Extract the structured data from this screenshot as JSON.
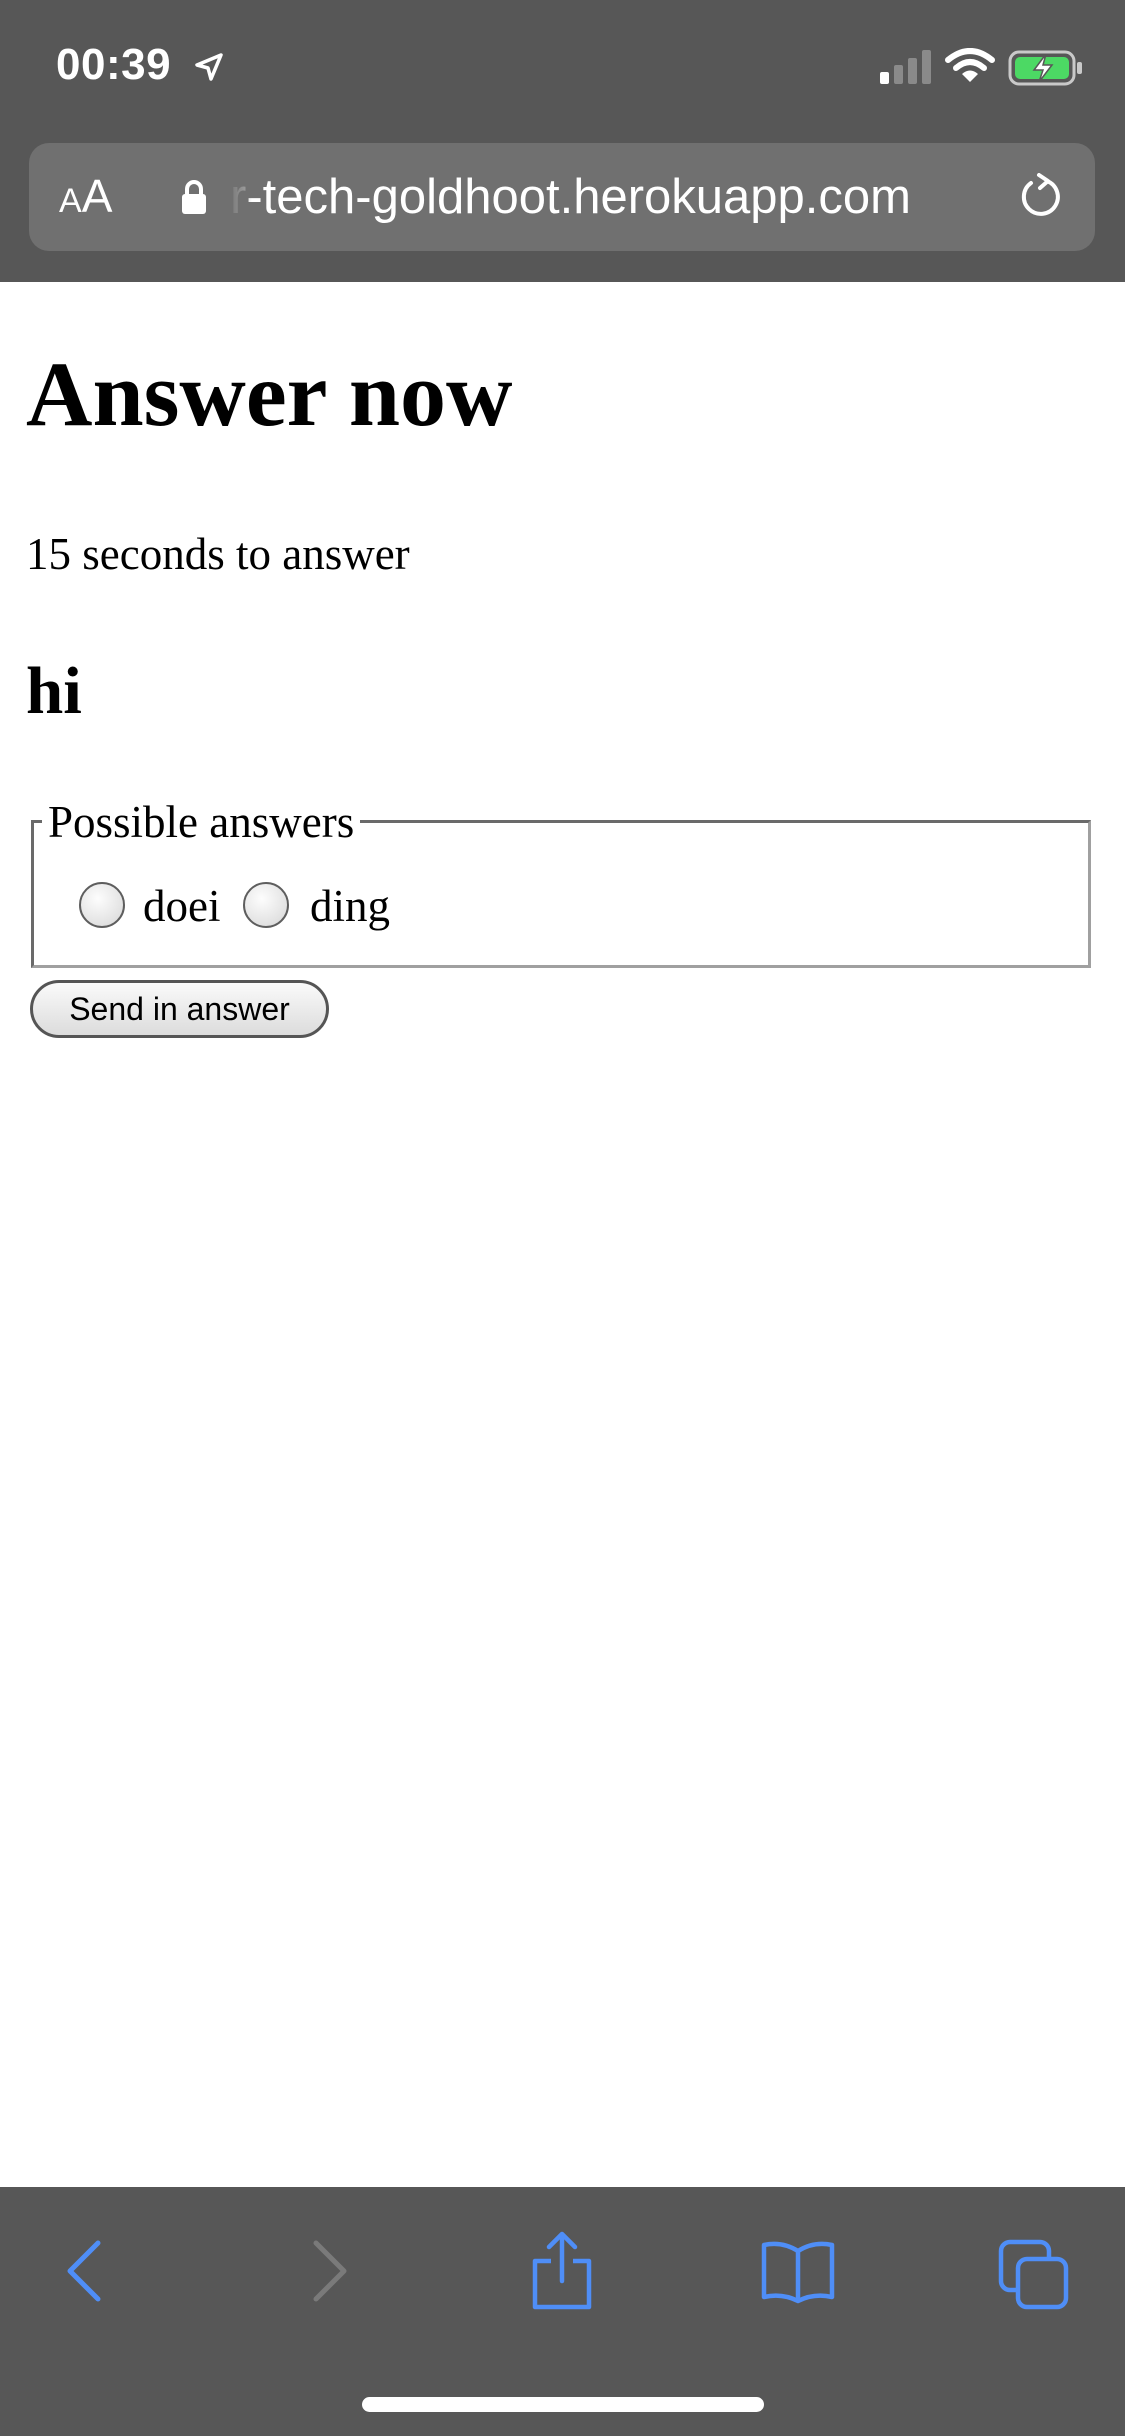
{
  "status_bar": {
    "time": "00:39"
  },
  "browser": {
    "aa_label_small": "A",
    "aa_label_large": "A",
    "url_fragment": "r",
    "url": "-tech-goldhoot.herokuapp.com"
  },
  "page": {
    "title": "Answer now",
    "timer_text": "15 seconds to answer",
    "question": "hi",
    "answers_legend": "Possible answers",
    "options": [
      {
        "label": "doei",
        "selected": false
      },
      {
        "label": "ding",
        "selected": false
      }
    ],
    "submit_label": "Send in answer"
  },
  "colors": {
    "chrome_background": "#575757",
    "url_bar_background": "#707070",
    "toolbar_accent": "#4f8ef7",
    "battery_fill": "#4cd964"
  },
  "icons": {
    "status": [
      "location-arrow-icon",
      "cellular-signal-icon",
      "wifi-icon",
      "battery-charging-icon"
    ],
    "address_bar": [
      "lock-icon",
      "reload-icon"
    ],
    "toolbar": [
      "back-icon",
      "forward-icon",
      "share-icon",
      "bookmarks-icon",
      "tabs-icon"
    ]
  }
}
